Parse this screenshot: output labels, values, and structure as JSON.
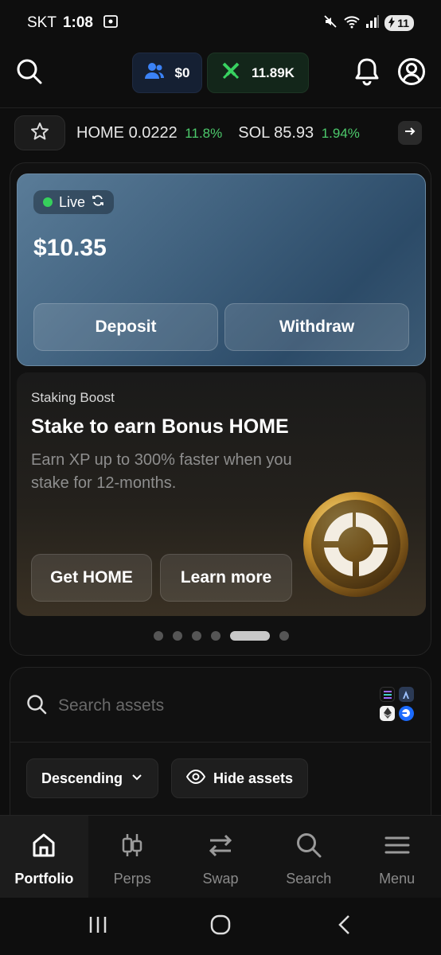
{
  "status_bar": {
    "carrier": "SKT",
    "time": "1:08",
    "battery": "11"
  },
  "header": {
    "users_value": "$0",
    "xp_value": "11.89K"
  },
  "ticker": {
    "items": [
      {
        "symbol": "HOME",
        "price": "0.0222",
        "change": "11.8%"
      },
      {
        "symbol": "SOL",
        "price": "85.93",
        "change": "1.94%"
      }
    ]
  },
  "balance_card": {
    "status": "Live",
    "balance": "$10.35",
    "deposit_label": "Deposit",
    "withdraw_label": "Withdraw"
  },
  "promo_card": {
    "kicker": "Staking Boost",
    "title": "Stake to earn Bonus HOME",
    "description": "Earn XP up to 300% faster when you stake for 12-months.",
    "get_label": "Get HOME",
    "learn_label": "Learn more"
  },
  "carousel": {
    "count": 6,
    "active_index": 4
  },
  "assets": {
    "search_placeholder": "Search assets",
    "sort_label": "Descending",
    "hide_label": "Hide assets"
  },
  "bottom_nav": {
    "items": [
      {
        "label": "Portfolio",
        "icon": "home-icon"
      },
      {
        "label": "Perps",
        "icon": "candles-icon"
      },
      {
        "label": "Swap",
        "icon": "swap-icon"
      },
      {
        "label": "Search",
        "icon": "search-icon"
      },
      {
        "label": "Menu",
        "icon": "menu-icon"
      }
    ],
    "active": "Portfolio"
  },
  "colors": {
    "positive": "#4cc96b",
    "live": "#36d05c",
    "accent_blue": "#3b82f6",
    "accent_green": "#38d160"
  }
}
